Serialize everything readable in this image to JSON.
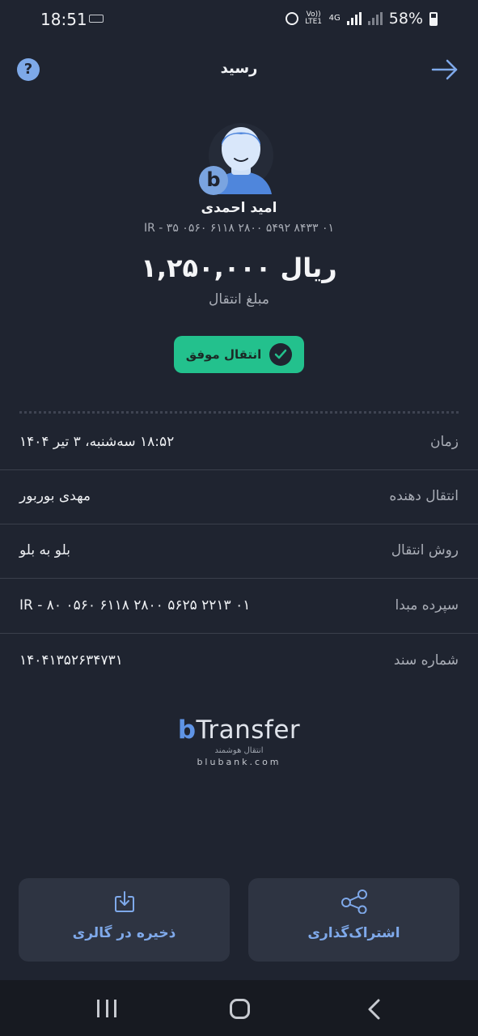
{
  "status_bar": {
    "time": "18:51",
    "volte": "Vo)) LTE1",
    "network": "4G",
    "battery": "58%"
  },
  "header": {
    "title": "رسید",
    "help": "?"
  },
  "recipient": {
    "badge": "b",
    "name": "امید احمدی",
    "iban": "IR - ۳۵ ۰۵۶۰ ۶۱۱۸ ۲۸۰۰ ۵۴۹۲ ۸۴۳۳ ۰۱"
  },
  "transfer": {
    "amount": "۱,۲۵۰,۰۰۰ ریال",
    "amount_label": "مبلغ انتقال",
    "status": "انتقال موفق",
    "status_color": "#23c18d"
  },
  "details": [
    {
      "label": "زمان",
      "value": "۱۸:۵۲ سه‌شنبه، ۳ تیر ۱۴۰۴"
    },
    {
      "label": "انتقال دهنده",
      "value": "مهدی بوربور"
    },
    {
      "label": "روش انتقال",
      "value": "بلو به بلو"
    },
    {
      "label": "سپرده مبدا",
      "value": "IR - ۸۰ ۰۵۶۰ ۶۱۱۸ ۲۸۰۰ ۵۶۲۵ ۲۲۱۳ ۰۱"
    },
    {
      "label": "شماره سند",
      "value": "۱۴۰۴۱۳۵۲۶۳۴۷۳۱"
    }
  ],
  "brand": {
    "logo_b": "b",
    "name": "Transfer",
    "tagline": "انتقال هوشمند",
    "url": "blubank.com"
  },
  "actions": {
    "save_label": "ذخیره در گالری",
    "share_label": "اشتراک‌گذاری"
  },
  "colors": {
    "background": "#1f2430",
    "accent": "#7fa9ea",
    "success": "#23c18d"
  }
}
